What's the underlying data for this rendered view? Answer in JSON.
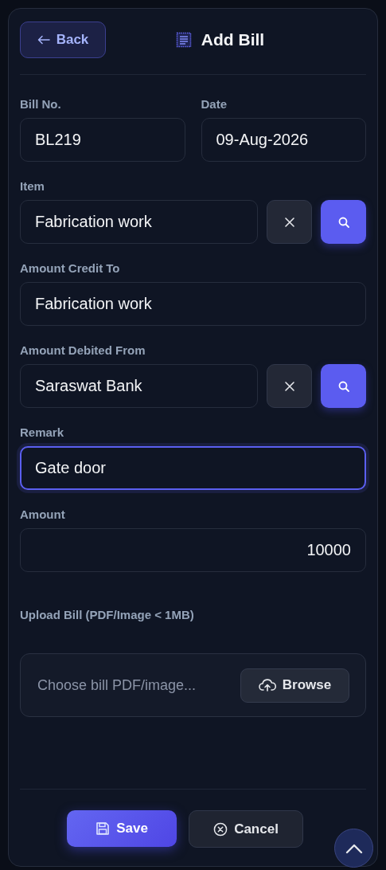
{
  "header": {
    "back_button": "Back",
    "title": "Add Bill"
  },
  "rows": [
    [
      {
        "label": "Bill No.",
        "value": "BL219",
        "kind": "text",
        "focused": false
      },
      {
        "label": "Date",
        "value": "09-Aug-2026",
        "kind": "text",
        "focused": false
      }
    ],
    [
      {
        "label": "Item",
        "value": "Fabrication work",
        "kind": "lookup",
        "focused": false
      }
    ],
    [
      {
        "label": "Amount Credit To",
        "value": "Fabrication work",
        "kind": "text",
        "focused": false
      }
    ],
    [
      {
        "label": "Amount Debited From",
        "value": "Saraswat Bank",
        "kind": "lookup",
        "focused": false
      }
    ],
    [
      {
        "label": "Remark",
        "value": "Gate door",
        "kind": "text",
        "focused": true
      }
    ],
    [
      {
        "label": "Amount",
        "value": "10000",
        "kind": "number",
        "focused": false
      }
    ]
  ],
  "upload": {
    "label": "Upload Bill (PDF/Image < 1MB)",
    "placeholder": "Choose bill PDF/image...",
    "button": "Browse"
  },
  "actions": {
    "save": "Save",
    "cancel": "Cancel"
  }
}
